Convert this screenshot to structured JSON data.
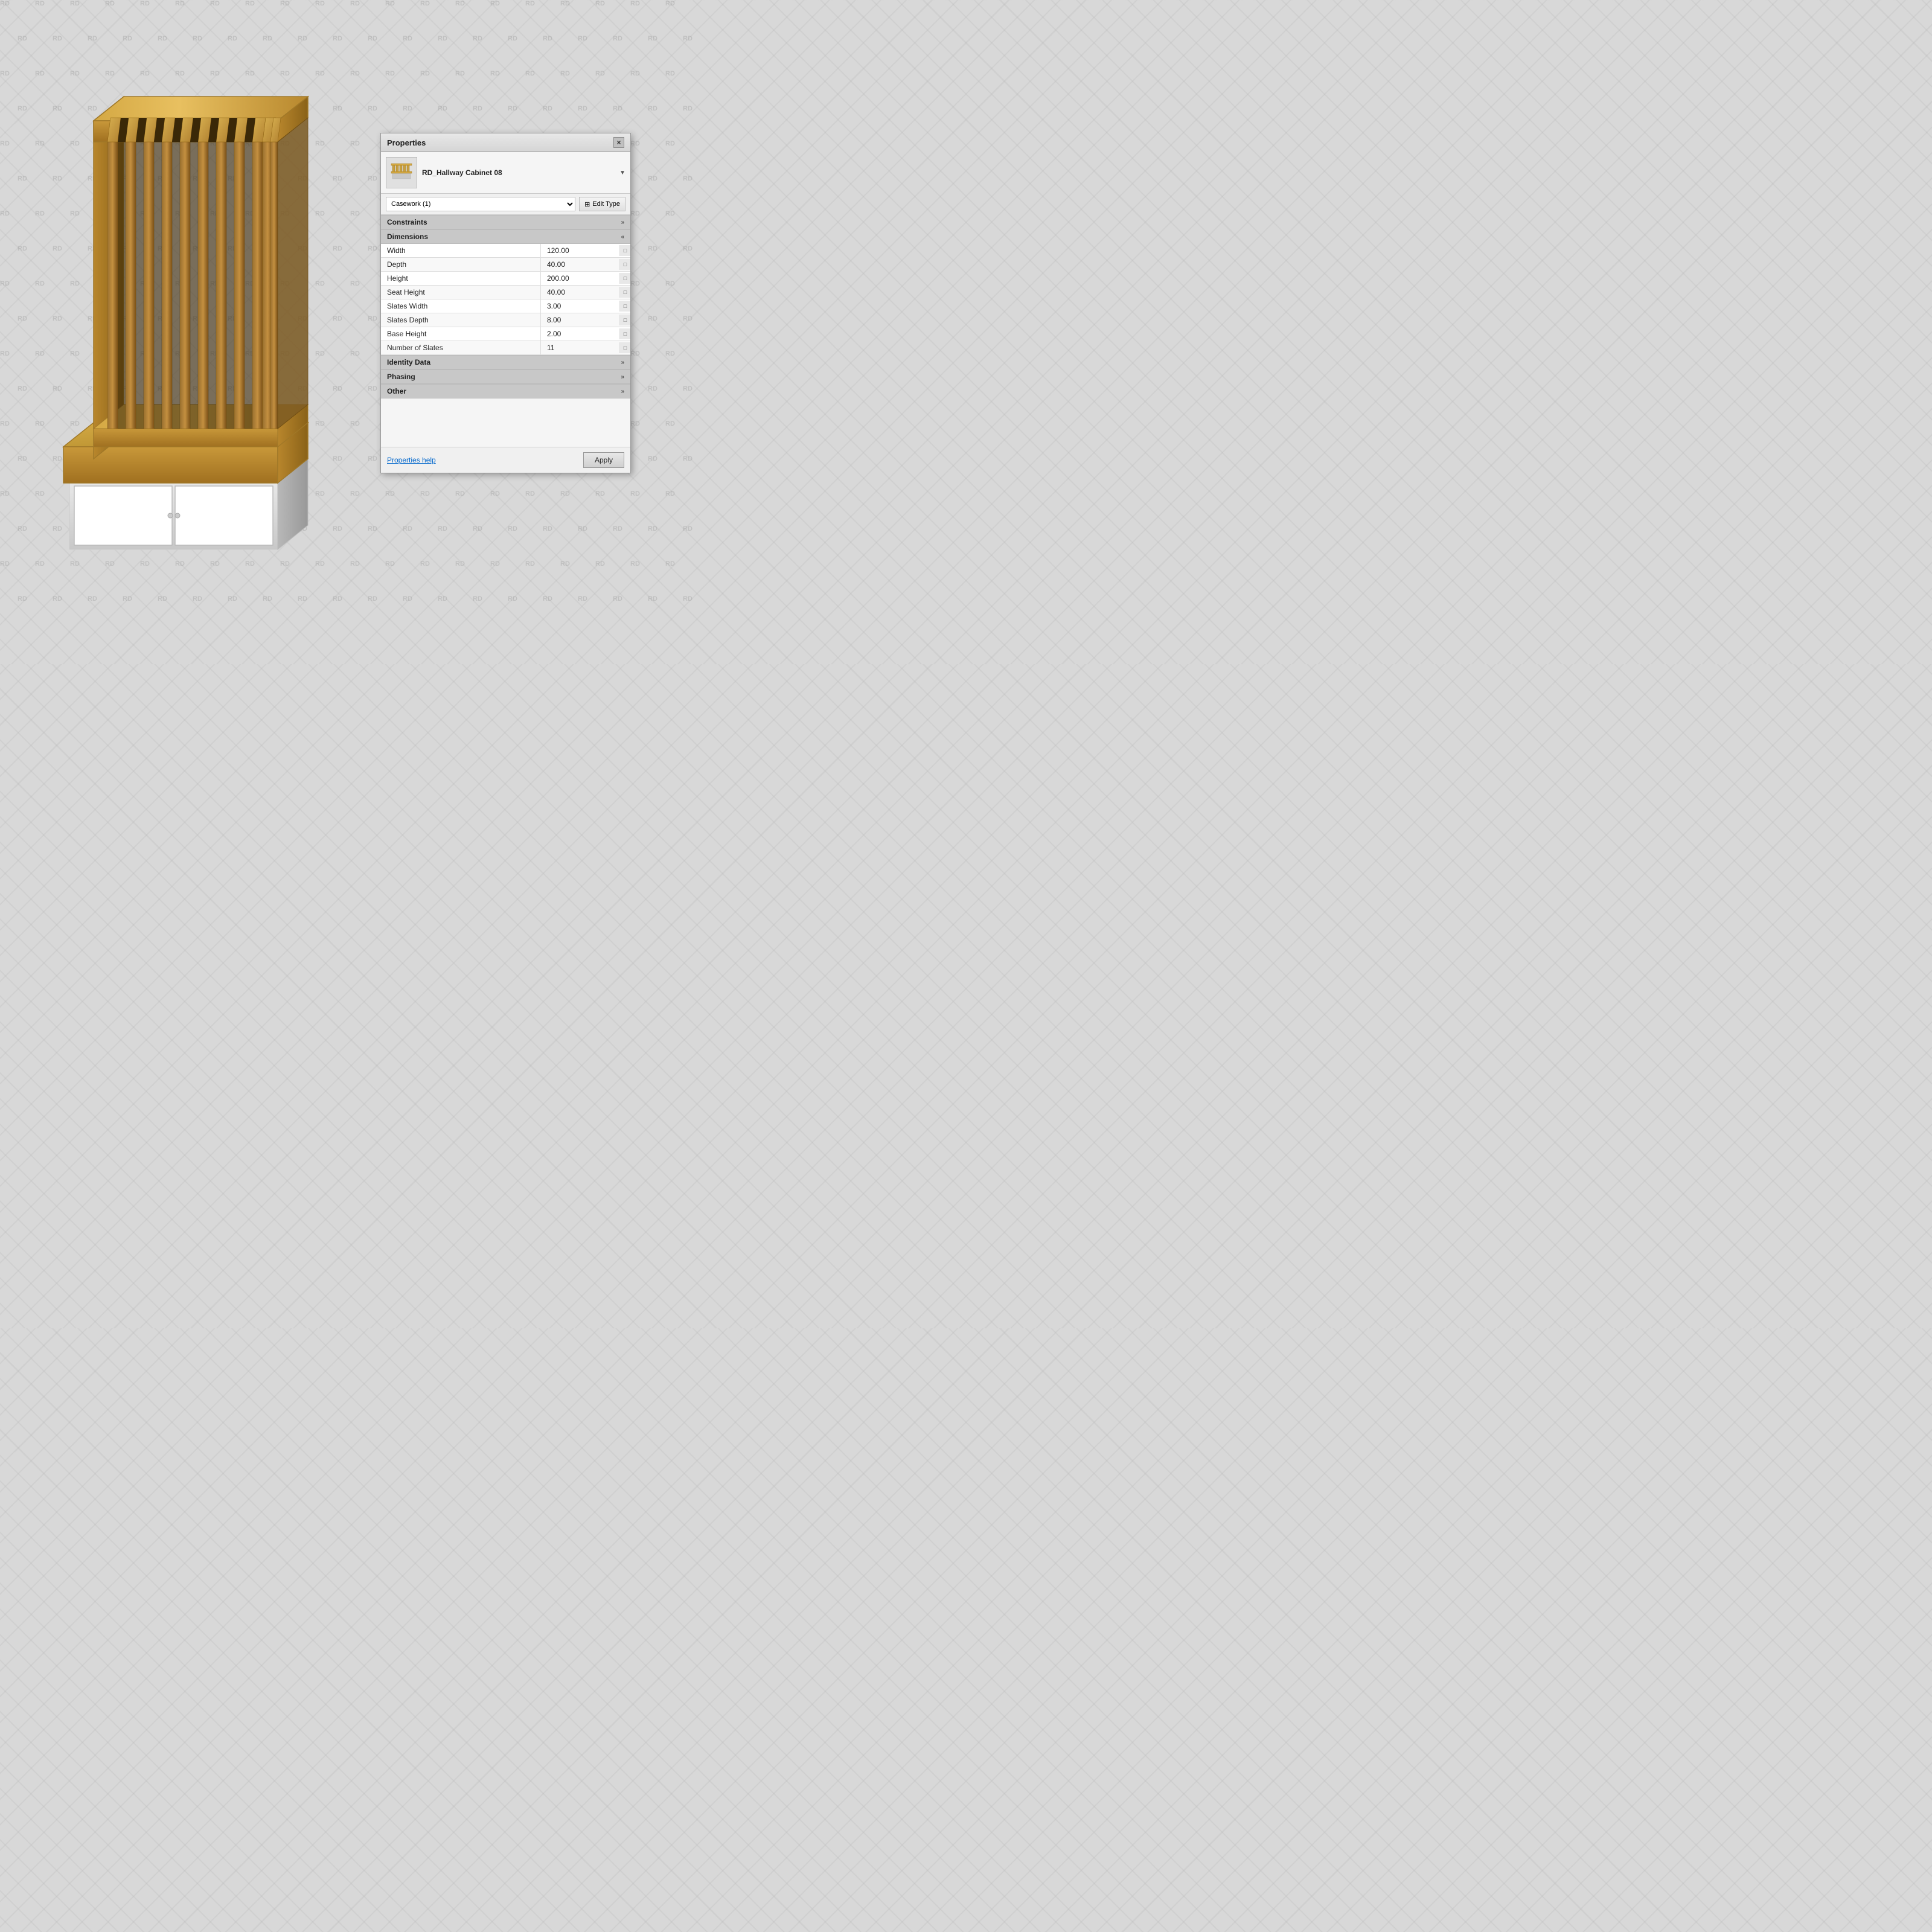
{
  "panel": {
    "title": "Properties",
    "close_label": "×",
    "item_name": "RD_Hallway Cabinet 08",
    "category": "Casework (1)",
    "edit_type_label": "Edit Type",
    "sections": {
      "constraints": {
        "label": "Constraints",
        "collapsed": true,
        "chevron": "»"
      },
      "dimensions": {
        "label": "Dimensions",
        "chevron": "«",
        "properties": [
          {
            "label": "Width",
            "value": "120.00"
          },
          {
            "label": "Depth",
            "value": "40.00"
          },
          {
            "label": "Height",
            "value": "200.00"
          },
          {
            "label": "Seat Height",
            "value": "40.00"
          },
          {
            "label": "Slates Width",
            "value": "3.00"
          },
          {
            "label": "Slates Depth",
            "value": "8.00"
          },
          {
            "label": "Base Height",
            "value": "2.00"
          },
          {
            "label": "Number of Slates",
            "value": "11"
          }
        ]
      },
      "identity_data": {
        "label": "Identity Data",
        "collapsed": true,
        "chevron": "»"
      },
      "phasing": {
        "label": "Phasing",
        "collapsed": true,
        "chevron": "»"
      },
      "other": {
        "label": "Other",
        "collapsed": true,
        "chevron": "»"
      }
    },
    "footer": {
      "help_link": "Properties help",
      "apply_label": "Apply"
    }
  },
  "icons": {
    "close": "✕",
    "edit_type_icon": "⊞",
    "dropdown_arrow": "▼",
    "chevron_collapsed": "»",
    "chevron_expanded": "«"
  }
}
